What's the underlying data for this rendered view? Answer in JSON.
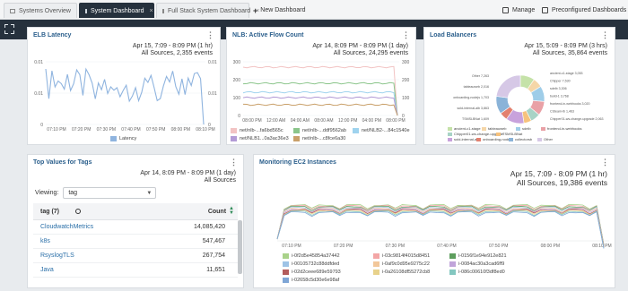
{
  "tabs": [
    {
      "label": "Systems Overview",
      "active": false
    },
    {
      "label": "System Dashboard",
      "active": true
    },
    {
      "label": "Full Stack System Dashboard",
      "active": false
    }
  ],
  "new_dashboard_label": "New Dashboard",
  "manage_label": "Manage",
  "preconfigured_label": "Preconfigured Dashboards",
  "panels": {
    "elb": {
      "title": "ELB Latency",
      "time_range": "Apr 15, 7:09 - 8:09 PM  (1 hr)",
      "events": "All Sources, 2,355 events",
      "y_left": [
        "0.01",
        "0.01",
        "0"
      ],
      "y_right": [
        "0.01",
        "0.01",
        "0"
      ],
      "x_ticks": [
        "07:10 PM",
        "07:20 PM",
        "07:30 PM",
        "07:40 PM",
        "07:50 PM",
        "08:00 PM",
        "08:10 PM"
      ],
      "legend": [
        "Latency"
      ],
      "color": "#8fb4df"
    },
    "nlb": {
      "title": "NLB: Active Flow Count",
      "time_range": "Apr 14, 8:09 PM - 8:09 PM  (1 day)",
      "events": "All Sources, 24,295 events",
      "y_left": [
        "300",
        "200",
        "100",
        "0"
      ],
      "y_right": [
        "300",
        "200",
        "100",
        "0"
      ],
      "x_ticks": [
        "08:00 PM",
        "12:00 AM",
        "04:00 AM",
        "08:00 AM",
        "12:00 PM",
        "04:00 PM",
        "08:00 PM"
      ],
      "legend": [
        "net/nlb-...fa6bd565c",
        "net/nlb-...ddf9562ab",
        "net/NLB2-...84c1540e",
        "net/NLB1...0a3ac36e3",
        "net/nlb-...c8fce6a30"
      ],
      "colors": [
        "#f2c3c3",
        "#8bc58b",
        "#9fd3ee",
        "#b39bd6",
        "#c9a06a"
      ]
    },
    "lb": {
      "title": "Load Balancers",
      "time_range": "Apr 15, 5:09 - 8:09 PM  (3 hrs)",
      "events": "All Sources, 35,864 events",
      "left_labels": [
        "Other 7,263",
        "tableauweb 2,016",
        "onboarding-nodejs 1,703",
        "sold-internal-alb 3,863",
        "TSMSLBNat 1,609"
      ],
      "right_labels": [
        "ancient-c1-stage 3,053",
        "Chipper 7,530",
        "sdelb 3,306",
        "build-1 3,768",
        "frontend-in-webhooks 3,020",
        "CSteam-lb 1,463",
        "Chipper01-ws-change-upgrade 2,063"
      ],
      "legend": [
        "ancient-c1-stage",
        "tableauweb",
        "sdelb",
        "frontend-in-webhooks",
        "Chipper01-ws-change-upgrade",
        "TSMSLBNat",
        "sold-internal-alb",
        "onboarding-nodejs",
        "collectorsb",
        "Other"
      ],
      "values": [
        3053,
        2016,
        3306,
        3020,
        2063,
        1609,
        3863,
        1703,
        3768,
        7263
      ],
      "colors": [
        "#c5e2a8",
        "#f5d6a8",
        "#9fcde8",
        "#e9a1a6",
        "#a8d3c6",
        "#f6c27d",
        "#c8a2dc",
        "#e3806f",
        "#8ab3d8",
        "#d6c8e6"
      ]
    },
    "topvalues": {
      "title": "Top Values for Tags",
      "time_range": "Apr 14, 8:09 PM - 8:09 PM  (1 day)",
      "events": "All Sources",
      "viewing_label": "Viewing:",
      "viewing_value": "tag",
      "col_tag": "tag (7)",
      "col_count": "Count",
      "rows": [
        {
          "tag": "CloudwatchMetrics",
          "count": "14,085,420"
        },
        {
          "tag": "k8s",
          "count": "547,467"
        },
        {
          "tag": "RsyslogTLS",
          "count": "267,754"
        },
        {
          "tag": "Java",
          "count": "11,651"
        }
      ]
    },
    "ec2": {
      "title": "Monitoring EC2 Instances",
      "time_range": "Apr 15, 7:09 - 8:09 PM  (1 hr)",
      "events": "All Sources, 19,386 events",
      "x_ticks": [
        "07:10 PM",
        "07:20 PM",
        "07:30 PM",
        "07:40 PM",
        "07:50 PM",
        "08:00 PM",
        "08:10 PM"
      ],
      "legend": [
        "i-0f2d5e45854a37442",
        "i-03c9814f4015d8451",
        "i-0156f1e94e912e821",
        "i-00105732c88ddfded",
        "i-0af9c0d95e9275c22",
        "i-0084ac30a3cad6ff9",
        "i-02d2ceee689e59793",
        "i-0a26108df55272cb8",
        "i-086c00610f3df8ed0",
        "i-02658c5d30e6e98af"
      ],
      "colors": [
        "#a9d28a",
        "#f3a6a6",
        "#5e9e5e",
        "#9ec3e6",
        "#f2c79a",
        "#c0a4da",
        "#b35c5c",
        "#e8d28b",
        "#84c7c0",
        "#7fa6d6"
      ]
    }
  }
}
